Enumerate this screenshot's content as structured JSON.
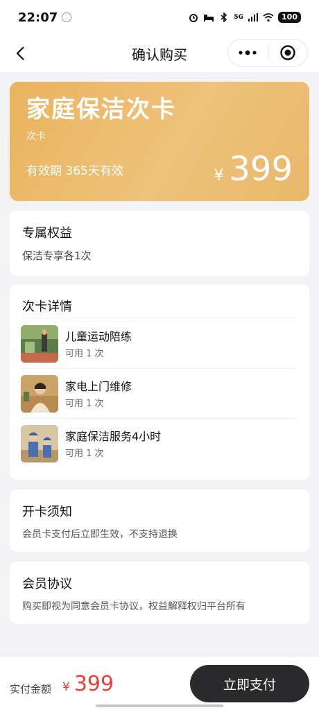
{
  "status_bar": {
    "time": "22:07",
    "network": "5G",
    "battery": "100"
  },
  "nav": {
    "title": "确认购买"
  },
  "card": {
    "title": "家庭保洁次卡",
    "subtitle": "次卡",
    "validity": "有效期 365天有效",
    "currency": "¥",
    "price": "399"
  },
  "benefits": {
    "title": "专属权益",
    "text": "保洁专享各1次"
  },
  "details": {
    "title": "次卡详情",
    "items": [
      {
        "name": "儿童运动陪练",
        "count": "可用 1 次"
      },
      {
        "name": "家电上门维修",
        "count": "可用 1 次"
      },
      {
        "name": "家庭保洁服务4小时",
        "count": "可用 1 次"
      }
    ]
  },
  "notice": {
    "title": "开卡须知",
    "text": "会员卡支付后立即生效，不支持退换"
  },
  "agreement": {
    "title": "会员协议",
    "text": "购买即视为同意会员卡协议，权益解释权归平台所有"
  },
  "footer": {
    "total_label": "实付金额",
    "currency": "¥",
    "total": "399",
    "pay_button": "立即支付"
  },
  "colors": {
    "accent": "#e8413c",
    "card_gold": "#e9b35f",
    "button_dark": "#2b2b2d"
  }
}
